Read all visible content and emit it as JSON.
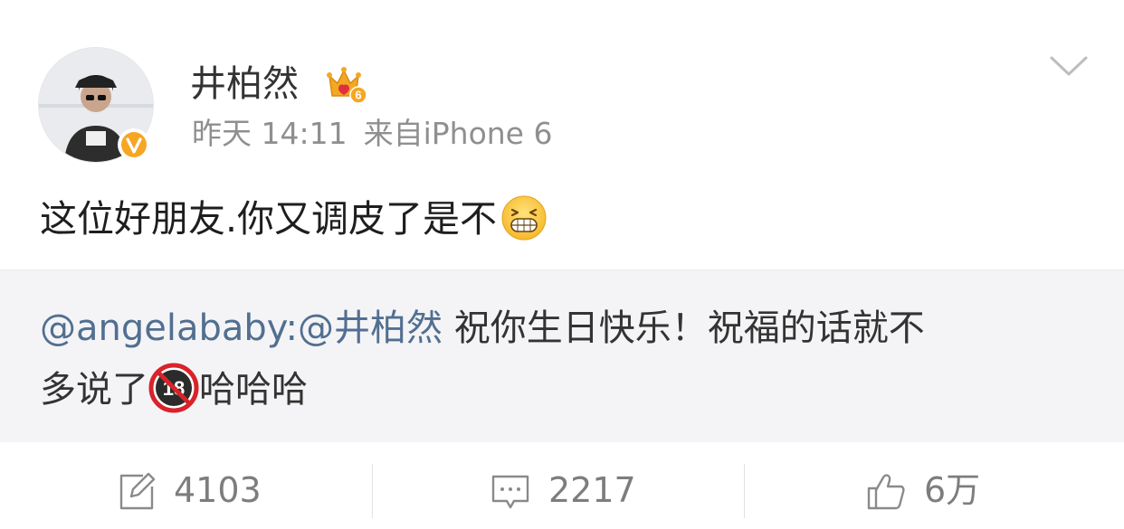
{
  "post": {
    "author": {
      "name": "井柏然",
      "avatar_icon": "avatar-photo",
      "verified_icon": "verified-v-badge",
      "member_badge_icon": "crown-level-6-badge",
      "member_badge_text": "6"
    },
    "meta": {
      "time": "昨天 14:11",
      "source": "来自iPhone 6"
    },
    "content": {
      "text": "这位好朋友.你又调皮了是不",
      "emoji_icon": "grinning-face-emoji"
    },
    "repost": {
      "mention_author": "@angelababy:",
      "mention_target": "@井柏然",
      "text_line1": " 祝你生日快乐！祝福的话就不",
      "text_line2a": "多说了",
      "emoji_icon": "no-under-18-emoji",
      "emoji_text": "18",
      "text_line2b": "哈哈哈"
    },
    "actions": {
      "repost": {
        "icon": "edit-icon",
        "count": "4103"
      },
      "comment": {
        "icon": "comment-icon",
        "count": "2217"
      },
      "like": {
        "icon": "thumbs-up-icon",
        "count": "6万"
      }
    },
    "colors": {
      "mention": "#526f91",
      "verified": "#f6a623",
      "crown": "#f3a824",
      "repost_bg": "#f4f4f6"
    }
  }
}
